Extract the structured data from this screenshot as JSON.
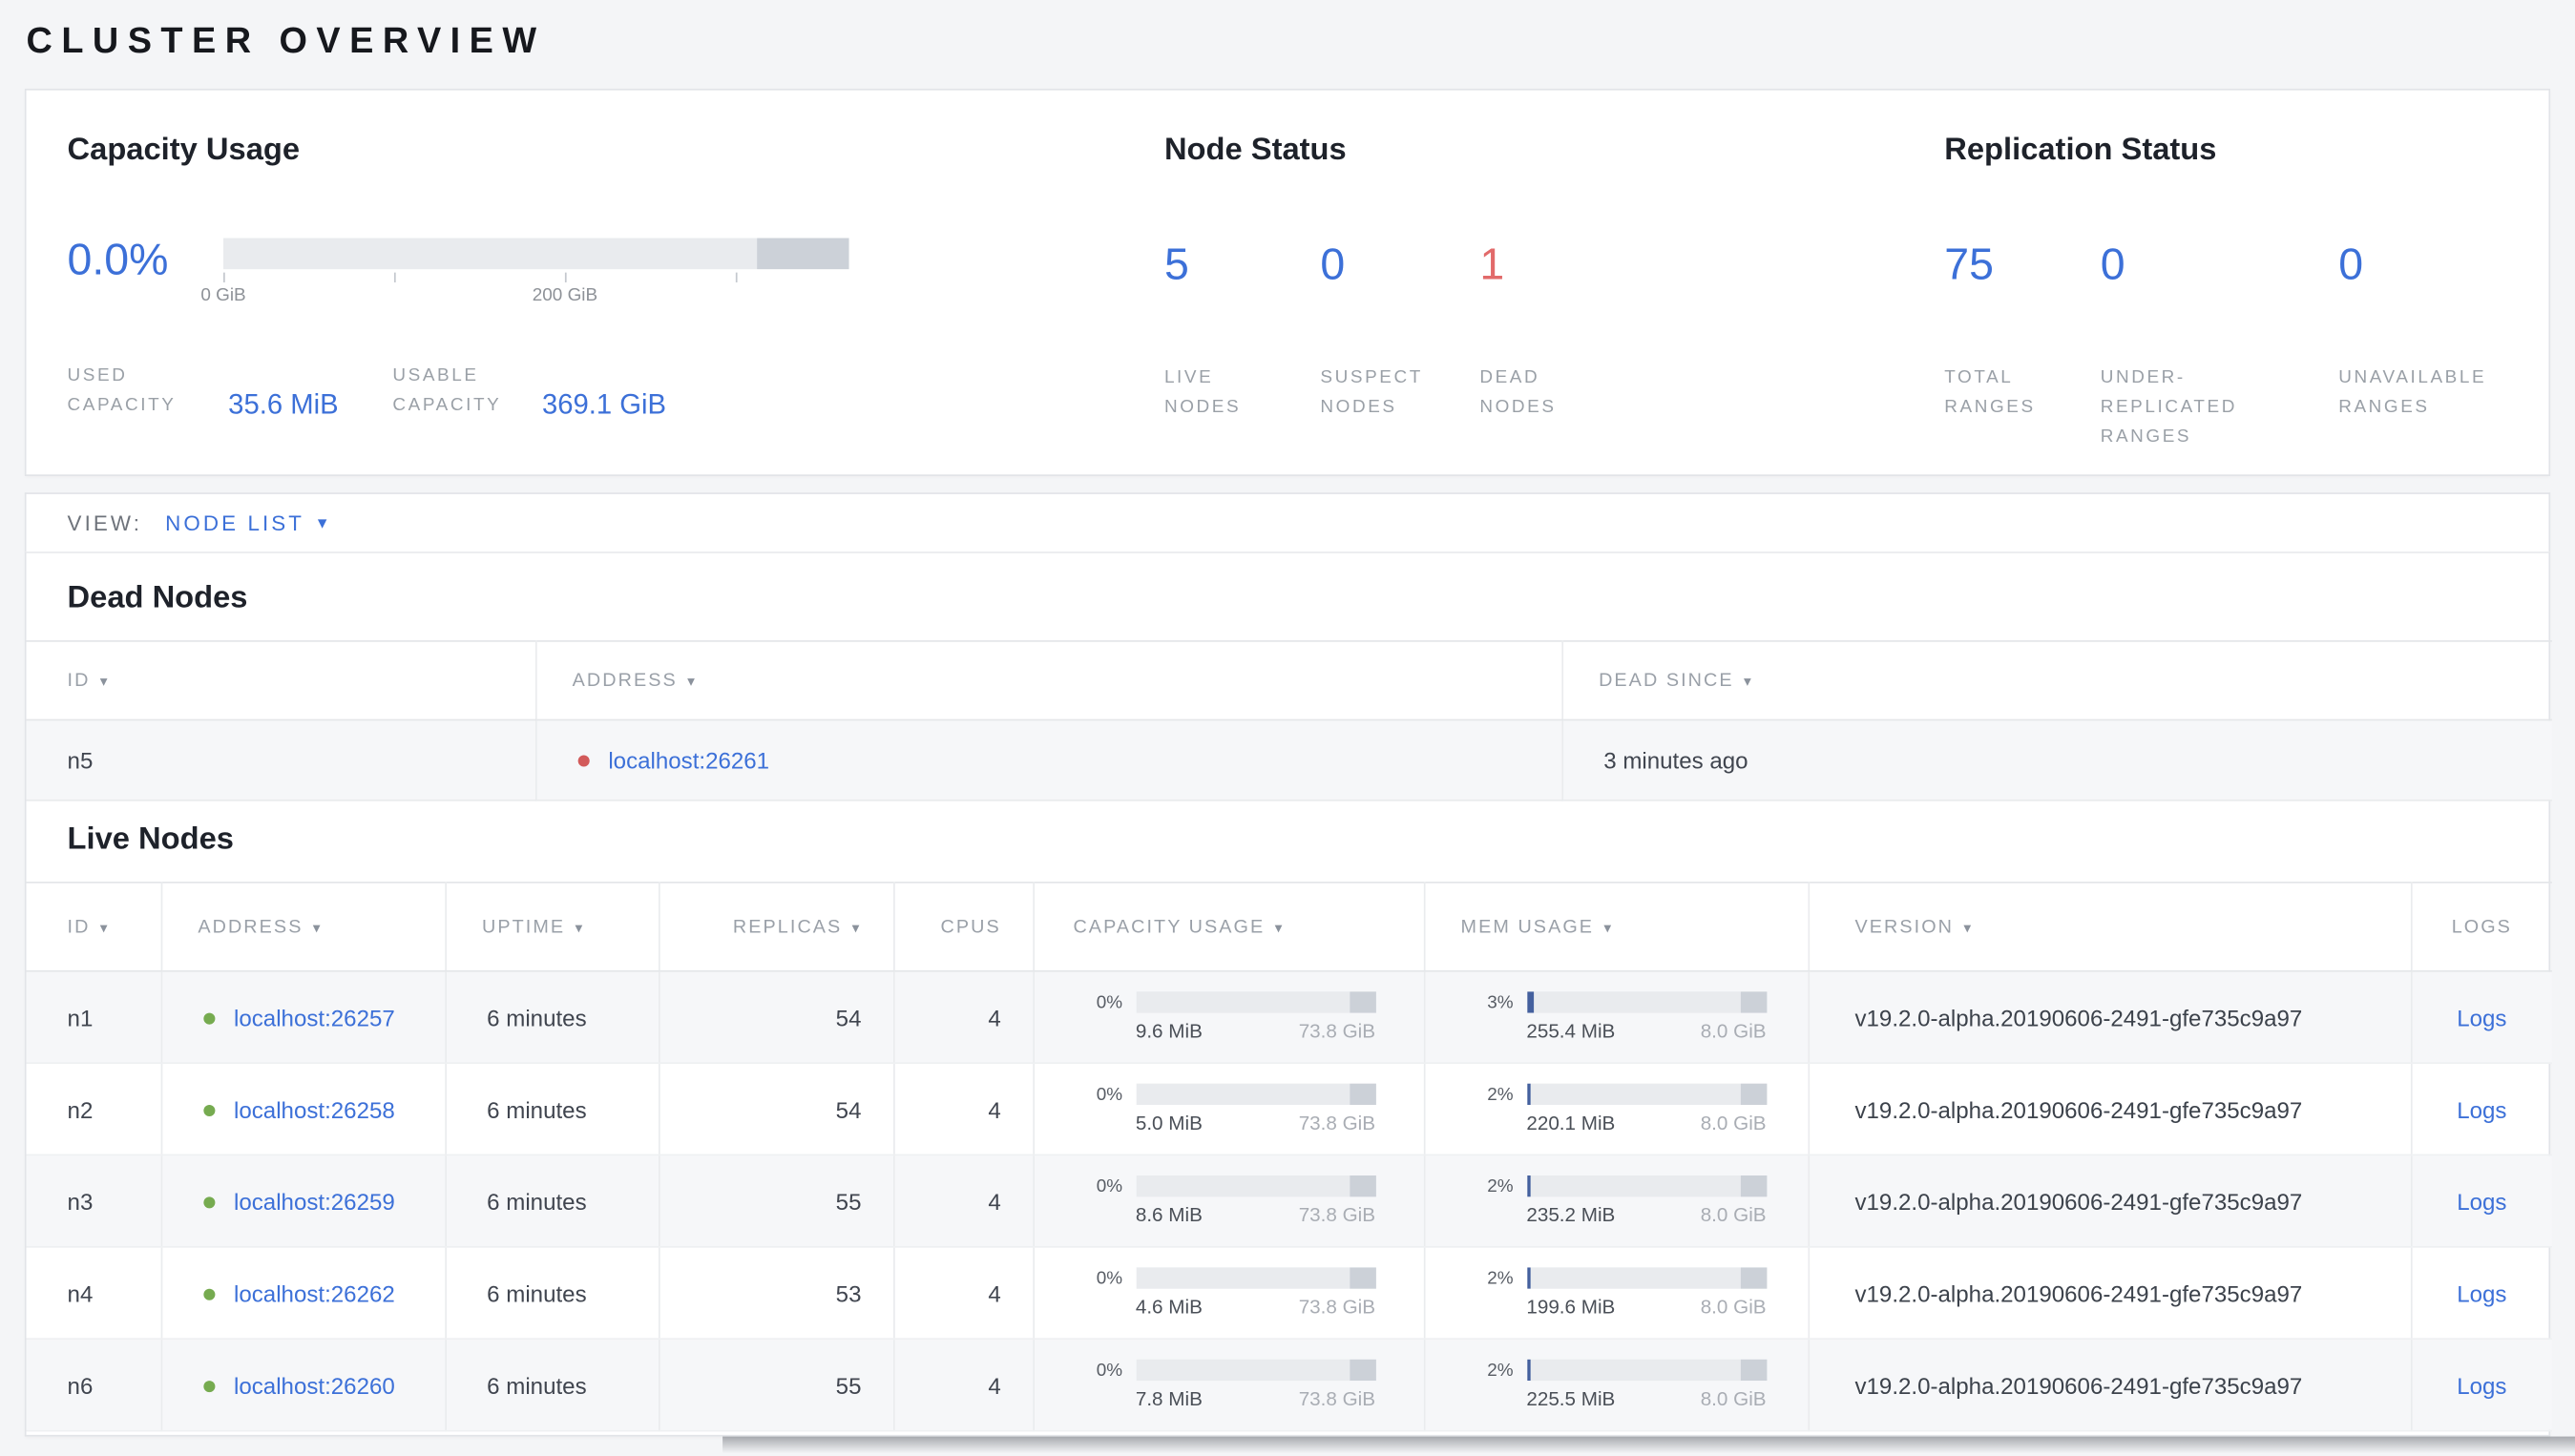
{
  "page_title": "CLUSTER OVERVIEW",
  "ui": {
    "sort_arrow": "▾",
    "dropdown_caret": "▾"
  },
  "overview": {
    "capacity": {
      "title": "Capacity Usage",
      "percent": "0.0%",
      "bar_fill": "0%",
      "tick_labels": [
        "0 GiB",
        "200 GiB"
      ],
      "used_label": "USED CAPACITY",
      "used_value": "35.6 MiB",
      "usable_label": "USABLE CAPACITY",
      "usable_value": "369.1 GiB"
    },
    "node_status": {
      "title": "Node Status",
      "stats": [
        {
          "value": "5",
          "label": "LIVE NODES"
        },
        {
          "value": "0",
          "label": "SUSPECT NODES"
        },
        {
          "value": "1",
          "label": "DEAD NODES"
        }
      ]
    },
    "replication": {
      "title": "Replication Status",
      "stats": [
        {
          "value": "75",
          "label": "TOTAL RANGES"
        },
        {
          "value": "0",
          "label": "UNDER-REPLICATED RANGES"
        },
        {
          "value": "0",
          "label": "UNAVAILABLE RANGES"
        }
      ]
    }
  },
  "view_bar": {
    "label": "VIEW:",
    "selected": "NODE LIST"
  },
  "dead_nodes": {
    "title": "Dead Nodes",
    "columns": [
      {
        "label": "ID"
      },
      {
        "label": "ADDRESS"
      },
      {
        "label": "DEAD SINCE"
      }
    ],
    "rows": [
      {
        "id": "n5",
        "address": "localhost:26261",
        "dead_since": "3 minutes ago"
      }
    ]
  },
  "live_nodes": {
    "title": "Live Nodes",
    "columns": [
      {
        "label": "ID"
      },
      {
        "label": "ADDRESS"
      },
      {
        "label": "UPTIME"
      },
      {
        "label": "REPLICAS"
      },
      {
        "label": "CPUS"
      },
      {
        "label": "CAPACITY USAGE"
      },
      {
        "label": "MEM USAGE"
      },
      {
        "label": "VERSION"
      },
      {
        "label": "LOGS"
      }
    ],
    "rows": [
      {
        "id": "n1",
        "address": "localhost:26257",
        "uptime": "6 minutes",
        "replicas": "54",
        "cpus": "4",
        "capacity_percent": "0%",
        "capacity_fill": "0%",
        "capacity_used": "9.6 MiB",
        "capacity_total": "73.8 GiB",
        "mem_percent": "3%",
        "mem_fill": "3%",
        "mem_used": "255.4 MiB",
        "mem_total": "8.0 GiB",
        "version": "v19.2.0-alpha.20190606-2491-gfe735c9a97",
        "logs_label": "Logs"
      },
      {
        "id": "n2",
        "address": "localhost:26258",
        "uptime": "6 minutes",
        "replicas": "54",
        "cpus": "4",
        "capacity_percent": "0%",
        "capacity_fill": "0%",
        "capacity_used": "5.0 MiB",
        "capacity_total": "73.8 GiB",
        "mem_percent": "2%",
        "mem_fill": "2%",
        "mem_used": "220.1 MiB",
        "mem_total": "8.0 GiB",
        "version": "v19.2.0-alpha.20190606-2491-gfe735c9a97",
        "logs_label": "Logs"
      },
      {
        "id": "n3",
        "address": "localhost:26259",
        "uptime": "6 minutes",
        "replicas": "55",
        "cpus": "4",
        "capacity_percent": "0%",
        "capacity_fill": "0%",
        "capacity_used": "8.6 MiB",
        "capacity_total": "73.8 GiB",
        "mem_percent": "2%",
        "mem_fill": "2%",
        "mem_used": "235.2 MiB",
        "mem_total": "8.0 GiB",
        "version": "v19.2.0-alpha.20190606-2491-gfe735c9a97",
        "logs_label": "Logs"
      },
      {
        "id": "n4",
        "address": "localhost:26262",
        "uptime": "6 minutes",
        "replicas": "53",
        "cpus": "4",
        "capacity_percent": "0%",
        "capacity_fill": "0%",
        "capacity_used": "4.6 MiB",
        "capacity_total": "73.8 GiB",
        "mem_percent": "2%",
        "mem_fill": "2%",
        "mem_used": "199.6 MiB",
        "mem_total": "8.0 GiB",
        "version": "v19.2.0-alpha.20190606-2491-gfe735c9a97",
        "logs_label": "Logs"
      },
      {
        "id": "n6",
        "address": "localhost:26260",
        "uptime": "6 minutes",
        "replicas": "55",
        "cpus": "4",
        "capacity_percent": "0%",
        "capacity_fill": "0%",
        "capacity_used": "7.8 MiB",
        "capacity_total": "73.8 GiB",
        "mem_percent": "2%",
        "mem_fill": "2%",
        "mem_used": "225.5 MiB",
        "mem_total": "8.0 GiB",
        "version": "v19.2.0-alpha.20190606-2491-gfe735c9a97",
        "logs_label": "Logs"
      }
    ]
  }
}
